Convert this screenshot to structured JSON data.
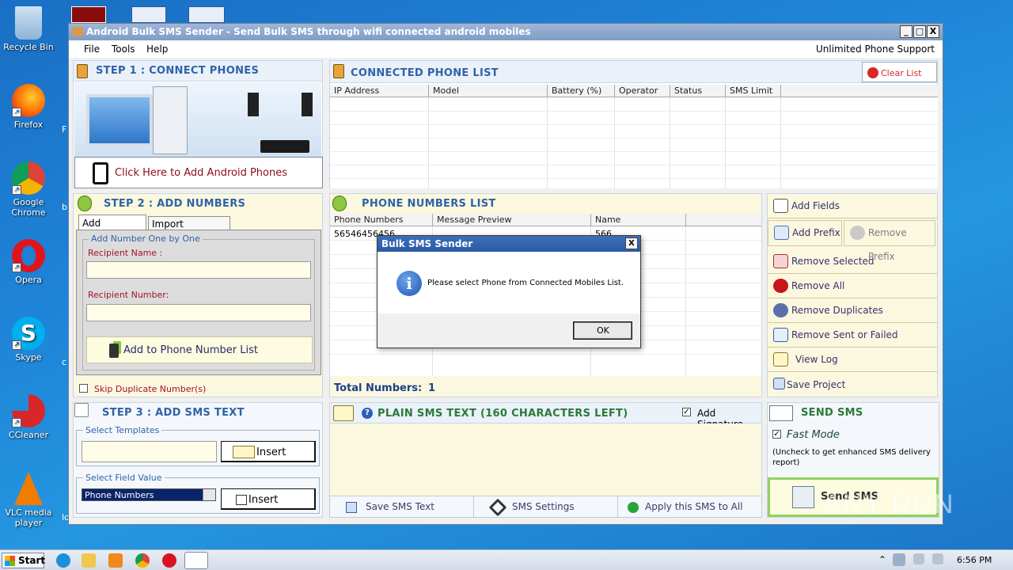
{
  "desktop": {
    "icons": [
      {
        "label": "Recycle Bin"
      },
      {
        "label": "Firefox"
      },
      {
        "label": "Google Chrome"
      },
      {
        "label": "Opera"
      },
      {
        "label": "Skype"
      },
      {
        "label": "CCleaner"
      },
      {
        "label": "VLC media player"
      }
    ],
    "partial_labels": [
      "F",
      "b",
      "c",
      "lo"
    ]
  },
  "window": {
    "title": "Android Bulk SMS Sender - Send Bulk SMS through wifi connected android mobiles",
    "controls": {
      "minimize": "_",
      "maximize": "□",
      "close": "X"
    },
    "menu": [
      "File",
      "Tools",
      "Help"
    ],
    "support_text": "Unlimited Phone Support"
  },
  "step1": {
    "header": "STEP 1 : CONNECT PHONES",
    "add_phones_button": "Click Here to Add Android Phones"
  },
  "connected_list": {
    "header": "CONNECTED PHONE LIST",
    "clear_button": "Clear List",
    "columns": [
      "IP Address",
      "Model",
      "Battery (%)",
      "Operator",
      "Status",
      "SMS Limit"
    ]
  },
  "step2": {
    "header": "STEP 2 : ADD NUMBERS",
    "tabs": [
      "Add Numbers",
      "Import Numbers"
    ],
    "group_label": "Add Number One by One",
    "recipient_name_label": "Recipient Name :",
    "recipient_number_label": "Recipient Number:",
    "add_button": "Add to Phone Number List",
    "skip_duplicates": "Skip Duplicate Number(s)"
  },
  "phone_list": {
    "header": "PHONE NUMBERS LIST",
    "columns": [
      "Phone Numbers",
      "Message Preview",
      "Name"
    ],
    "rows": [
      {
        "phone": "56546456456",
        "preview": "",
        "name": "566"
      }
    ],
    "total_label": "Total Numbers:",
    "total_value": "1"
  },
  "side_actions": {
    "add_fields": "Add Fields",
    "add_prefix": "Add Prefix",
    "remove_prefix": "Remove Prefix",
    "remove_selected": "Remove Selected",
    "remove_all": "Remove All",
    "remove_duplicates": "Remove Duplicates",
    "remove_sent_failed": "Remove Sent or Failed",
    "view_log": "View Log",
    "save_project": "Save Project"
  },
  "step3": {
    "header": "STEP 3 : ADD SMS TEXT",
    "templates_label": "Select Templates",
    "insert_label": "Insert",
    "field_value_label": "Select Field Value",
    "field_value_selected": "Phone Numbers",
    "insert2_label": "Insert"
  },
  "sms_text": {
    "header": "PLAIN SMS TEXT (160 CHARACTERS LEFT)",
    "add_signature": "Add Signature",
    "save_button": "Save SMS Text",
    "settings_button": "SMS Settings",
    "apply_button": "Apply this SMS to All"
  },
  "send": {
    "header": "SEND SMS",
    "fast_mode": "Fast Mode",
    "note": "(Uncheck to get enhanced SMS delivery report)",
    "send_button": "Send SMS"
  },
  "dialog": {
    "title": "Bulk SMS Sender",
    "close": "X",
    "message": "Please select Phone from Connected Mobiles List.",
    "ok": "OK"
  },
  "taskbar": {
    "start": "Start",
    "time": "6:56 PM"
  },
  "watermark": "ANY RUN"
}
